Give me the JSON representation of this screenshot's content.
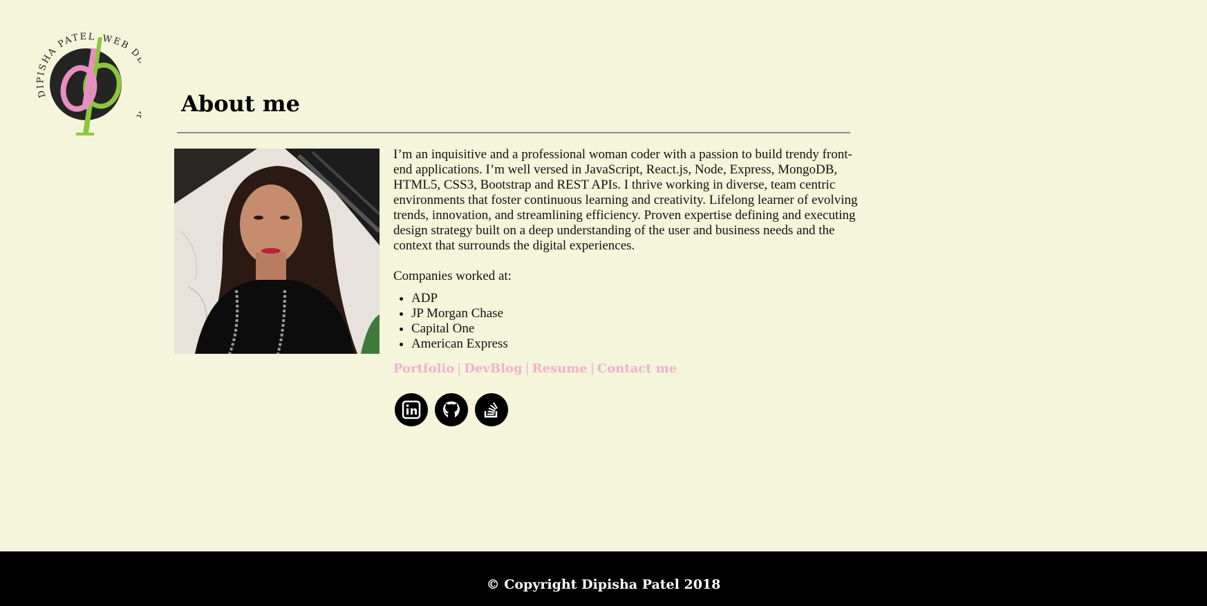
{
  "logo": {
    "text_top": "DIPISHA PATEL",
    "text_right": "WEB DEVELOPER",
    "monogram": "dp"
  },
  "about": {
    "heading": "About me",
    "bio": "I’m an inquisitive and a professional woman coder with a passion to build trendy front-end applications. I’m well versed in JavaScript, React.js, Node, Express, MongoDB, HTML5, CSS3, Bootstrap and REST APIs. I thrive working in diverse, team centric environments that foster continuous learning and creativity. Lifelong learner of evolving trends, innovation, and streamlining efficiency. Proven expertise defining and executing design strategy built on a deep understanding of the user and business needs and the context that surrounds the digital experiences.",
    "companies_label": "Companies worked at:",
    "companies": [
      "ADP",
      "JP Morgan Chase",
      "Capital One",
      "American Express"
    ]
  },
  "nav_links": {
    "portfolio": "Portfolio",
    "devblog": "DevBlog",
    "resume": "Resume",
    "contact": "Contact me",
    "separator": "|"
  },
  "social": {
    "icons": [
      "linkedin-icon",
      "github-icon",
      "stackoverflow-icon"
    ]
  },
  "footer": {
    "copyright": "© Copyright Dipisha Patel 2018"
  },
  "colors": {
    "background": "#f4f5da",
    "link_pink": "#f2b0d0",
    "logo_pink": "#e98ec0",
    "logo_green": "#8cc63f",
    "footer_bg": "#000000"
  }
}
